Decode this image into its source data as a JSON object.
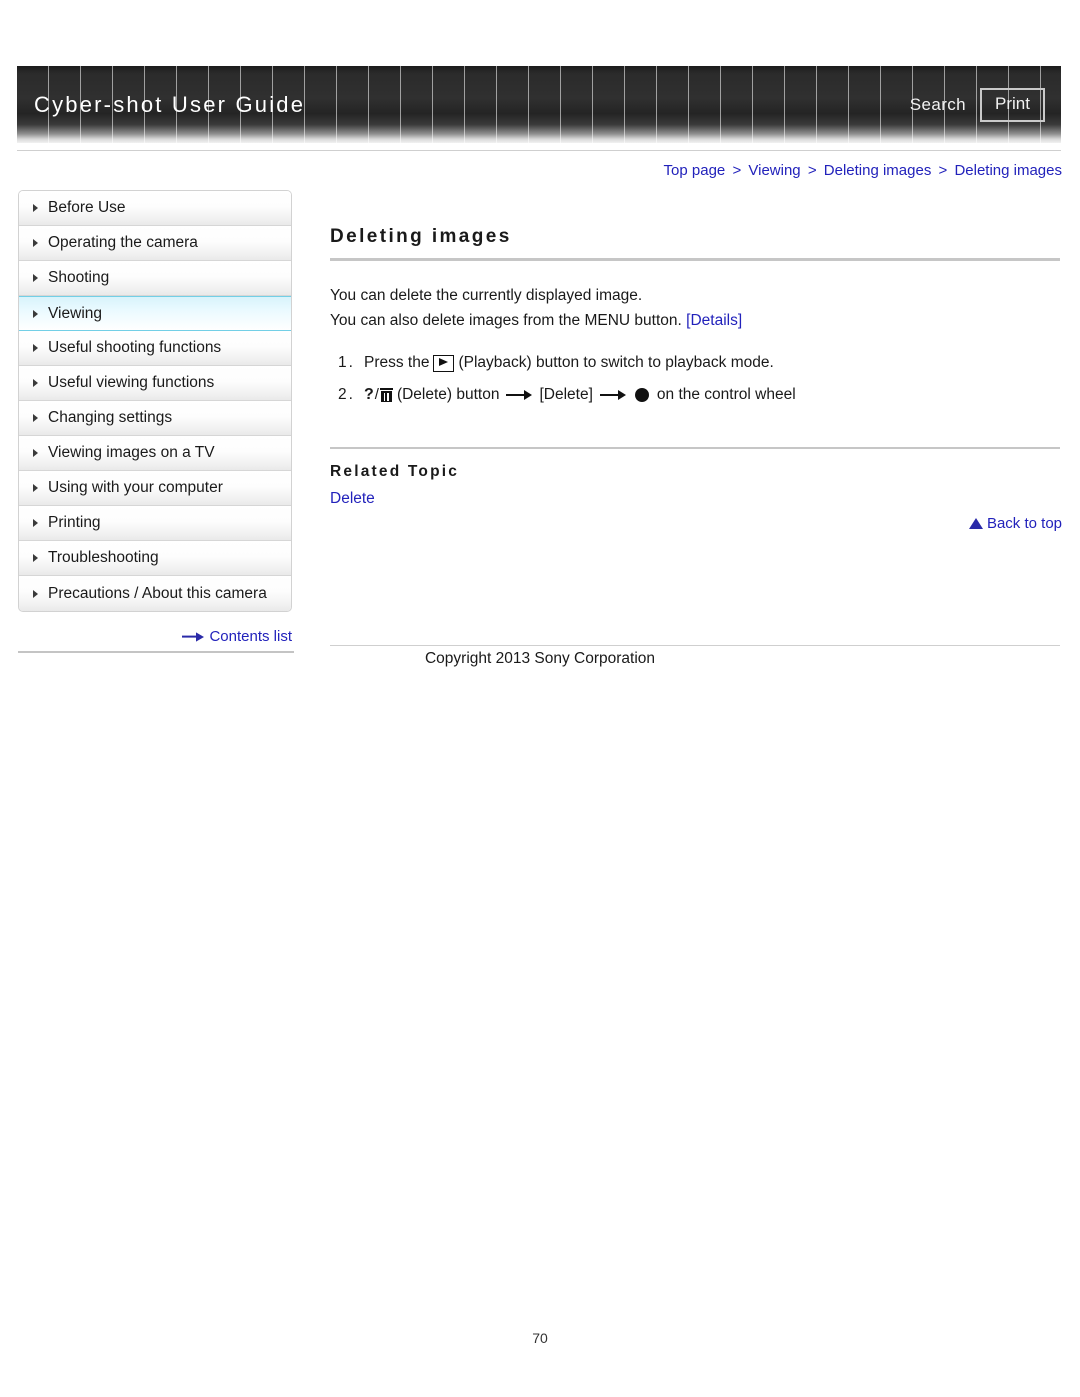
{
  "header": {
    "title": "Cyber-shot User Guide",
    "search_label": "Search",
    "print_label": "Print"
  },
  "breadcrumb": {
    "separator": ">",
    "items": [
      {
        "label": "Top page"
      },
      {
        "label": "Viewing"
      },
      {
        "label": "Deleting images"
      },
      {
        "label": "Deleting images"
      }
    ]
  },
  "sidebar": {
    "items": [
      {
        "label": "Before Use",
        "active": false
      },
      {
        "label": "Operating the camera",
        "active": false
      },
      {
        "label": "Shooting",
        "active": false
      },
      {
        "label": "Viewing",
        "active": true
      },
      {
        "label": "Useful shooting functions",
        "active": false
      },
      {
        "label": "Useful viewing functions",
        "active": false
      },
      {
        "label": "Changing settings",
        "active": false
      },
      {
        "label": "Viewing images on a TV",
        "active": false
      },
      {
        "label": "Using with your computer",
        "active": false
      },
      {
        "label": "Printing",
        "active": false
      },
      {
        "label": "Troubleshooting",
        "active": false
      },
      {
        "label": "Precautions / About this camera",
        "active": false
      }
    ],
    "contents_list_label": "Contents list"
  },
  "main": {
    "title": "Deleting images",
    "paragraph_1": "You can delete the currently displayed image.",
    "paragraph_2_text": "You can also delete images from the MENU button.",
    "paragraph_2_link": "[Details]",
    "steps": [
      {
        "number": "1.",
        "text_before_icon": "Press the",
        "icon": "playback-icon",
        "text_after_icon": "(Playback) button to switch to playback mode."
      },
      {
        "number": "2.",
        "icon": "question-trash-icon",
        "label_1": "(Delete) button",
        "arrow_1": "arrow-right-icon",
        "label_2": "[Delete]",
        "arrow_2": "arrow-right-icon",
        "dot": "control-wheel-center-dot",
        "label_3": "on the control wheel"
      }
    ],
    "related_topic_title": "Related Topic",
    "related_topic_link": "Delete",
    "back_to_top_label": "Back to top"
  },
  "footer": {
    "copyright": "Copyright 2013 Sony Corporation",
    "page_number": "70"
  },
  "colors": {
    "link": "#2222bb",
    "header_bg": "#2b2b2b",
    "active_nav": "#73cfe6"
  }
}
